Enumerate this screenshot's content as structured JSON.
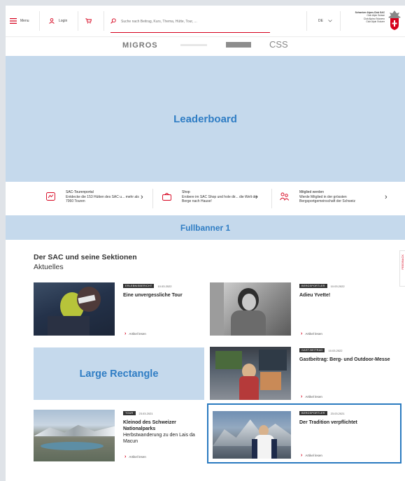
{
  "nav": {
    "menu_label": "Menu",
    "login_label": "Login",
    "search_placeholder": "Suche nach Beitrag, Kurs, Thema, Hütte, Tour, ...",
    "language": "DE",
    "club_name": "Schweizer Alpen-Club SAC",
    "club_name_lines": [
      "Club Alpin Suisse",
      "Club Alpino Svizzero",
      "Club Alpin Svizzer"
    ]
  },
  "sponsors": [
    "MIGROS",
    "CSS"
  ],
  "ads": {
    "leaderboard": "Leaderboard",
    "fullbanner": "Fullbanner 1",
    "large_rectangle": "Large Rectangle"
  },
  "quick_links": [
    {
      "title": "SAC-Tourenportal",
      "text": "Entdecke die 153 Hütten des SAC u... mehr als 7060 Touren",
      "icon": "map-icon"
    },
    {
      "title": "Shop",
      "text": "Erobere im SAC Shop und hole dir... die Welt der Berge nach Hause!",
      "icon": "basket-icon"
    },
    {
      "title": "Mitglied werden",
      "text": "Werde Mitglied in der grössten Bergsportgemeinschaft der Schweiz",
      "icon": "members-icon"
    }
  ],
  "section": {
    "title": "Der SAC und seine Sektionen",
    "subtitle": "Aktuelles"
  },
  "feedback_label": "FEEDBACK",
  "articles": [
    {
      "badge": "ERLEBNISBERICHT",
      "date": "10.03.2022",
      "title": "Eine unvergessliche Tour",
      "teaser": "",
      "more": "Artikel lesen"
    },
    {
      "badge": "BERGSPORTLER",
      "date": "10.03.2022",
      "title": "Adieu Yvette!",
      "teaser": "",
      "more": "Artikel lesen"
    },
    {
      "badge": "GAST-BEITRAG",
      "date": "10.03.2022",
      "title": "Gastbeitrag: Berg- und Outdoor-Messe",
      "teaser": "",
      "more": "Artikel lesen"
    },
    {
      "badge": "TOUR",
      "date": "23.03.2021",
      "title": "Kleinod des Schweizer Nationalparks",
      "teaser": "Herbstwanderung zu den Lais da Macun",
      "more": "Artikel lesen"
    },
    {
      "badge": "BERGSPORTLER",
      "date": "23.03.2021",
      "title": "Der Tradition verpflichtet",
      "teaser": "",
      "more": "Artikel lesen"
    }
  ],
  "colors": {
    "brand_red": "#d6001c",
    "ad_bg": "#c5d9ec",
    "ad_text": "#2f7dc4",
    "highlight": "#2a7ac0"
  }
}
